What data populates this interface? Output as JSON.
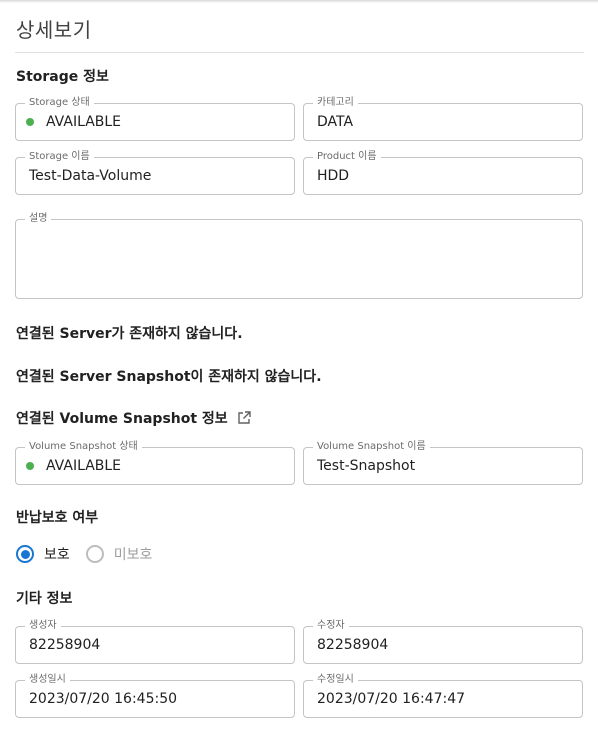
{
  "page_title": "상세보기",
  "storage_section": {
    "title": "Storage 정보",
    "status_label": "Storage 상태",
    "status_value": "AVAILABLE",
    "category_label": "카테고리",
    "category_value": "DATA",
    "name_label": "Storage 이름",
    "name_value": "Test-Data-Volume",
    "product_label": "Product 이름",
    "product_value": "HDD",
    "description_label": "설명",
    "description_value": ""
  },
  "server_message": "연결된 Server가 존재하지 않습니다.",
  "server_snapshot_message": "연결된 Server Snapshot이 존재하지 않습니다.",
  "volume_snapshot_section": {
    "title": "연결된 Volume Snapshot 정보",
    "status_label": "Volume Snapshot 상태",
    "status_value": "AVAILABLE",
    "name_label": "Volume Snapshot 이름",
    "name_value": "Test-Snapshot"
  },
  "return_protection": {
    "title": "반납보호 여부",
    "options": [
      "보호",
      "미보호"
    ],
    "selected": "보호"
  },
  "other_info": {
    "title": "기타 정보",
    "creator_label": "생성자",
    "creator_value": "82258904",
    "modifier_label": "수정자",
    "modifier_value": "82258904",
    "created_at_label": "생성일시",
    "created_at_value": "2023/07/20 16:45:50",
    "modified_at_label": "수정일시",
    "modified_at_value": "2023/07/20 16:47:47"
  },
  "colors": {
    "status_available": "#4caf50",
    "radio_selected": "#1976d2",
    "border": "#c4c4c4"
  },
  "icons": {
    "external_link": "external-link-icon"
  }
}
